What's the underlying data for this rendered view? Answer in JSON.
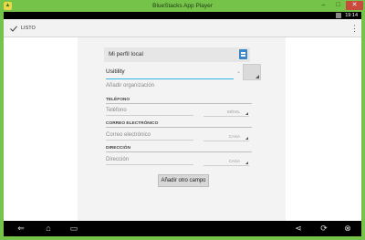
{
  "window": {
    "title": "BlueStacks App Player",
    "controls": [
      "–",
      "□",
      "✕"
    ]
  },
  "statusbar": {
    "time": "19:14"
  },
  "actionbar": {
    "done_label": "LISTO",
    "menu_icon": "overflow-menu-icon"
  },
  "contact": {
    "profile_label": "Mi perfil local",
    "name_value": "Usitility",
    "add_org_label": "Añadir organización",
    "phone": {
      "header": "TELÉFONO",
      "placeholder": "Teléfono",
      "type": "MÓVIL"
    },
    "email": {
      "header": "CORREO ELECTRÓNICO",
      "placeholder": "Correo electrónico",
      "type": "CASA"
    },
    "address": {
      "header": "DIRECCIÓN",
      "placeholder": "Dirección",
      "type": "CASA"
    },
    "add_field_label": "Añadir otro campo"
  },
  "colors": {
    "frame": "#76c34a",
    "accent": "#33b5e5",
    "close": "#c94b3e"
  }
}
